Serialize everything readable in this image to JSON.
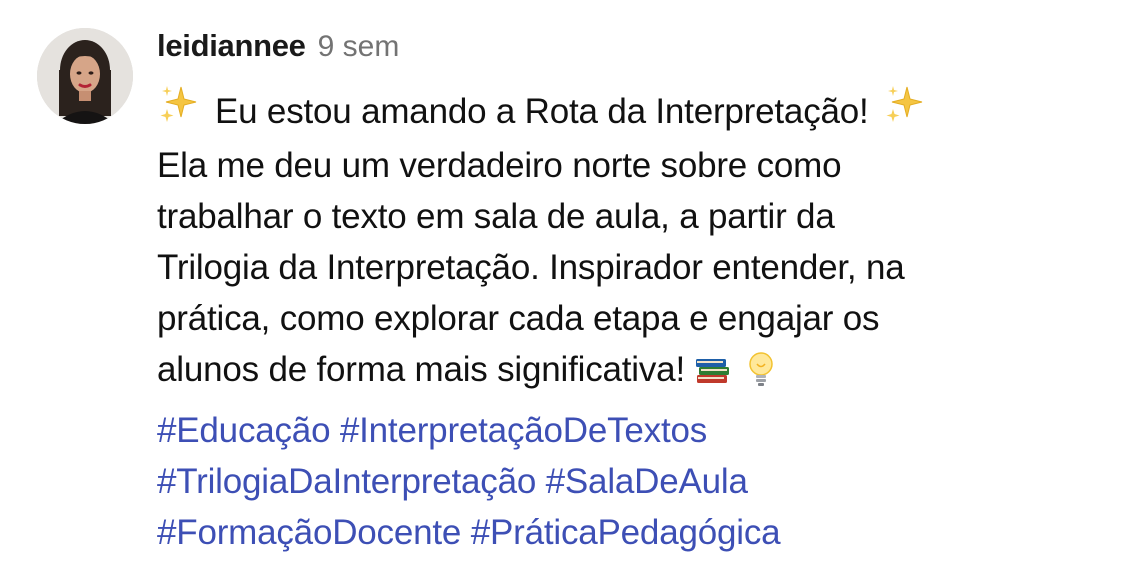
{
  "comment": {
    "username": "leidiannee",
    "time": "9 sem",
    "intro": "Eu estou amando a Rota da Interpretação!",
    "lines": [
      "Ela me deu um verdadeiro norte sobre como",
      "trabalhar o texto em sala de aula, a partir da",
      "Trilogia da Interpretação. Inspirador entender, na",
      "prática, como explorar cada etapa e engajar os",
      "alunos de forma mais significativa!"
    ],
    "hashtags": [
      [
        "#Educação",
        "#InterpretaçãoDeTextos"
      ],
      [
        "#TrilogiaDaInterpretação",
        "#SalaDeAula"
      ],
      [
        "#FormaçãoDocente",
        "#PráticaPedagógica"
      ]
    ],
    "icons": {
      "avatar": "avatar",
      "intro_left": "sparkles-icon",
      "intro_right": "sparkles-icon",
      "end_1": "books-icon",
      "end_2": "light-bulb-icon"
    },
    "colors": {
      "hashtag": "#3d4fb5",
      "time": "#737373",
      "text": "#111111"
    }
  }
}
